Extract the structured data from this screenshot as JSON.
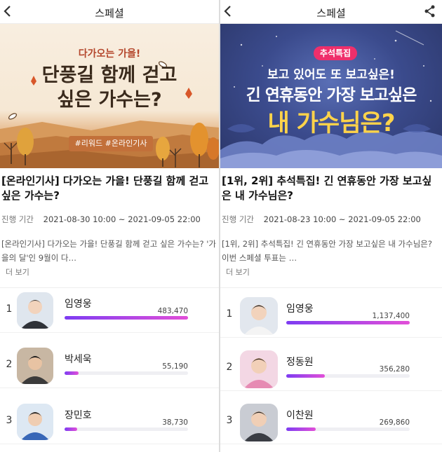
{
  "colors": {
    "bar_start": "#7d3cf2",
    "bar_end": "#e24fd8",
    "badge_pink": "#ef2f6b",
    "banner_title_yellow": "#ffd34a"
  },
  "icons": {
    "back": "back-arrow-icon",
    "share": "share-icon"
  },
  "left": {
    "header_title": "스페셜",
    "banner": {
      "subtitle": "다가오는 가을!",
      "title": "단풍길 함께 걷고\n싶은 가수는?",
      "hashtags": "#리워드 #온라인기사"
    },
    "post_title": "[온라인기사] 다가오는 가을! 단풍길 함께 걷고 싶은 가수는?",
    "period_label": "진행 기간",
    "period_value": "2021-08-30 10:00 ~ 2021-09-05 22:00",
    "description": "[온라인기사] 다가오는 가을! 단풍길 함께 걷고 싶은 가수는? '가을의 달'인 9월이 다…",
    "more": "더 보기",
    "rankings": [
      {
        "rank": "1",
        "name": "임영웅",
        "votes": "483,470",
        "share": 1.0
      },
      {
        "rank": "2",
        "name": "박세욱",
        "votes": "55,190",
        "share": 0.114
      },
      {
        "rank": "3",
        "name": "장민호",
        "votes": "38,730",
        "share": 0.08
      }
    ]
  },
  "right": {
    "header_title": "스페셜",
    "banner": {
      "badge": "추석특집",
      "line1": "보고 있어도 또 보고싶은!",
      "line2": "긴 연휴동안 가장 보고싶은",
      "line3": "내 가수님은?"
    },
    "post_title": "[1위, 2위] 추석특집! 긴 연휴동안 가장 보고싶은 내 가수님은?",
    "period_label": "진행 기간",
    "period_value": "2021-08-23 10:00 ~ 2021-09-05 22:00",
    "description": "[1위, 2위] 추석특집! 긴 연휴동안 가장 보고싶은 내 가수님은? 이번 스페셜 투표는 …",
    "more": "더 보기",
    "rankings": [
      {
        "rank": "1",
        "name": "임영웅",
        "votes": "1,137,400",
        "share": 1.0
      },
      {
        "rank": "2",
        "name": "정동원",
        "votes": "356,280",
        "share": 0.313
      },
      {
        "rank": "3",
        "name": "이찬원",
        "votes": "269,860",
        "share": 0.237
      }
    ]
  }
}
